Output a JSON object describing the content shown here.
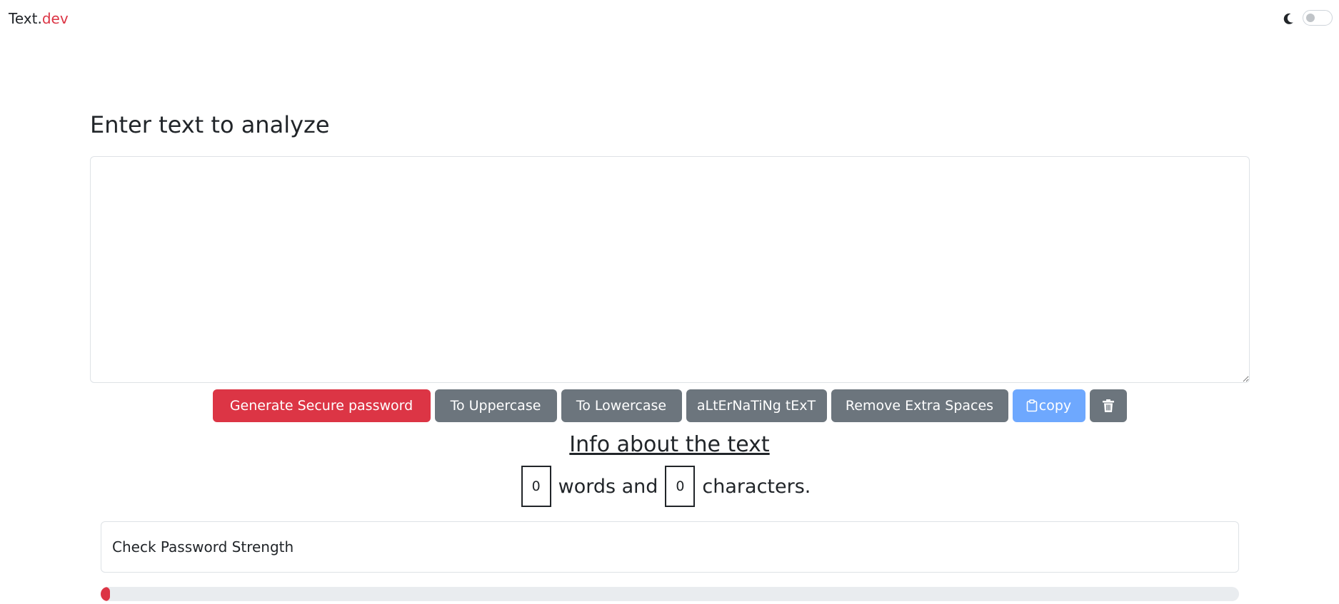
{
  "navbar": {
    "brand_main": "Text.",
    "brand_accent": "dev",
    "theme_icon": "moon-icon",
    "dark_mode_enabled": false
  },
  "main": {
    "heading": "Enter text to analyze",
    "textarea_value": "",
    "buttons": {
      "generate": "Generate Secure password",
      "uppercase": "To Uppercase",
      "lowercase": "To Lowercase",
      "alternating": "aLtErNaTiNg tExT",
      "remove_spaces": "Remove Extra Spaces",
      "copy": "copy",
      "copy_icon": "clipboard-icon",
      "clear_icon": "trash-icon"
    },
    "info": {
      "title": "Info about the text",
      "words_count": "0",
      "words_label": "words and",
      "chars_count": "0",
      "chars_label": "characters."
    },
    "password": {
      "placeholder": "Check Password Strength",
      "strength_fraction": 0.008
    }
  },
  "colors": {
    "accent": "#dc3545",
    "secondary": "#6c757d",
    "copy_button": "#6ea8fe"
  }
}
